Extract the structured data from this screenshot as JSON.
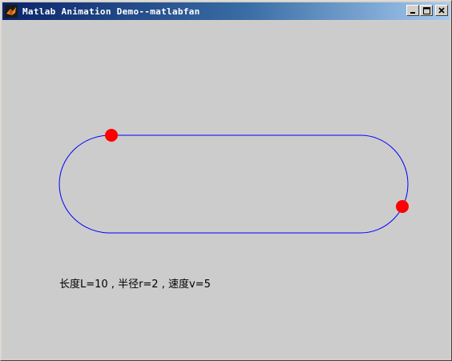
{
  "window": {
    "title": "Matlab Animation Demo--matlabfan",
    "app_icon": "matlab-logo-icon",
    "buttons": [
      {
        "name": "minimize",
        "icon": "minimize-icon"
      },
      {
        "name": "maximize",
        "icon": "maximize-icon"
      },
      {
        "name": "close",
        "icon": "close-icon"
      }
    ]
  },
  "figure": {
    "background_color": "#cccccc",
    "track_color": "#0000ff",
    "ball_color": "#ff0000",
    "caption": "长度L=10 , 半径r=2 , 速度v=5"
  }
}
